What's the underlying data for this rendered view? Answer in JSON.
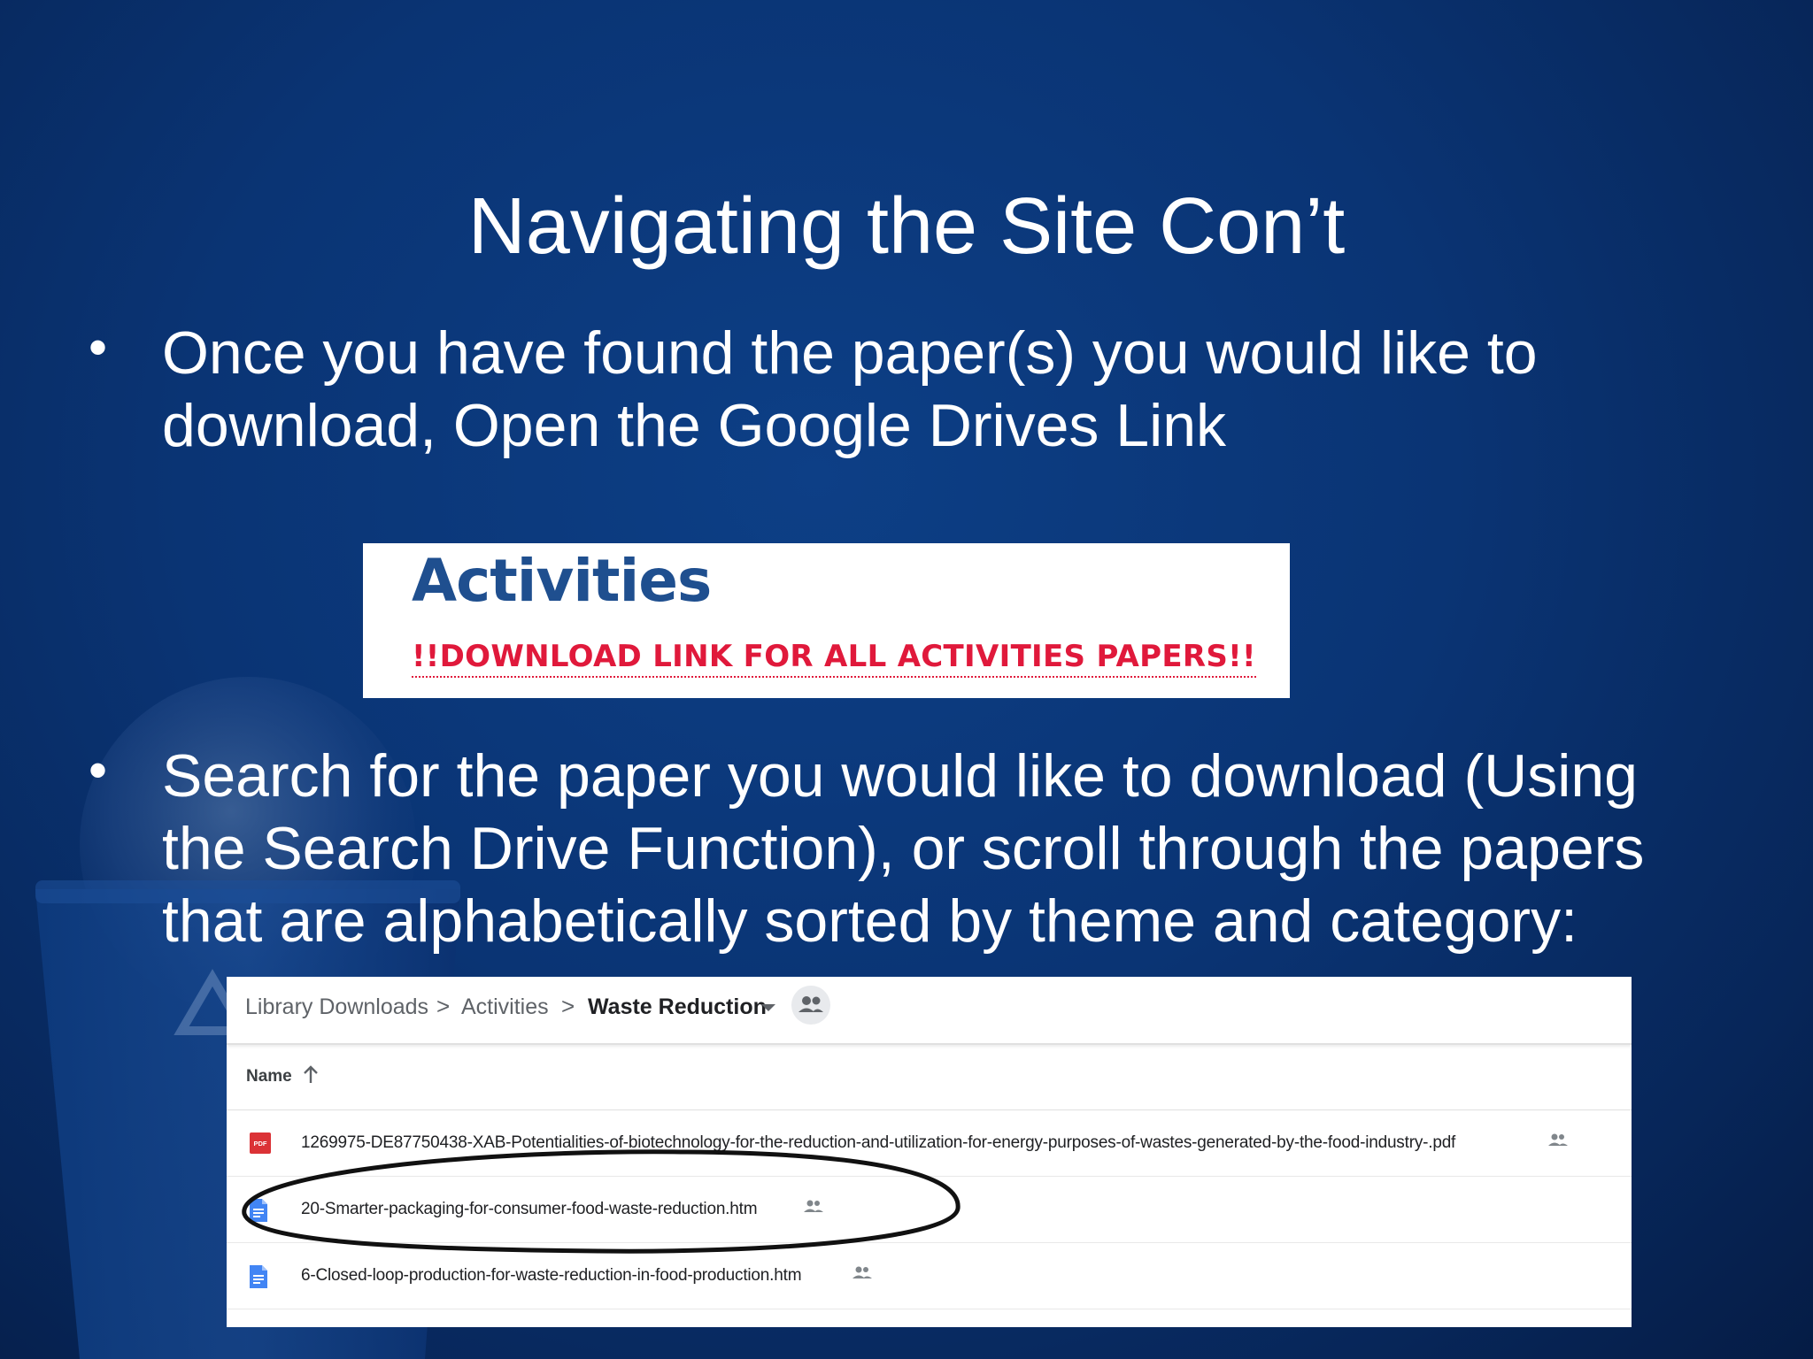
{
  "slide": {
    "title": "Navigating the Site Con’t",
    "bullet1": "Once you have found the paper(s) you would like to download, Open the Google Drives Link",
    "bullet2": "Search for the paper you would like to download (Using the Search Drive Function), or scroll through the papers that are alphabetically sorted by theme and category:",
    "bullet_glyph": "•"
  },
  "activities": {
    "heading": "Activities",
    "download_link": "!!DOWNLOAD LINK FOR ALL ACTIVITIES PAPERS!!",
    "link_color": "#e0193b",
    "heading_color": "#1f4f8f"
  },
  "drive": {
    "breadcrumb": [
      {
        "label": "Library Downloads"
      },
      {
        "label": "Activities"
      },
      {
        "label": "Waste Reduction"
      }
    ],
    "separator": ">",
    "column_header": "Name",
    "files": [
      {
        "type": "pdf-icon",
        "badge": "PDF",
        "name": "1269975-DE87750438-XAB-Potentialities-of-biotechnology-for-the-reduction-and-utilization-for-energy-purposes-of-wastes-generated-by-the-food-industry-.pdf"
      },
      {
        "type": "doc-icon",
        "name": "20-Smarter-packaging-for-consumer-food-waste-reduction.htm",
        "highlighted": true
      },
      {
        "type": "doc-icon",
        "name": "6-Closed-loop-production-for-waste-reduction-in-food-production.htm"
      }
    ]
  },
  "colors": {
    "background": "#0a3474",
    "pdf_icon": "#db3236",
    "doc_icon": "#4285f4"
  }
}
